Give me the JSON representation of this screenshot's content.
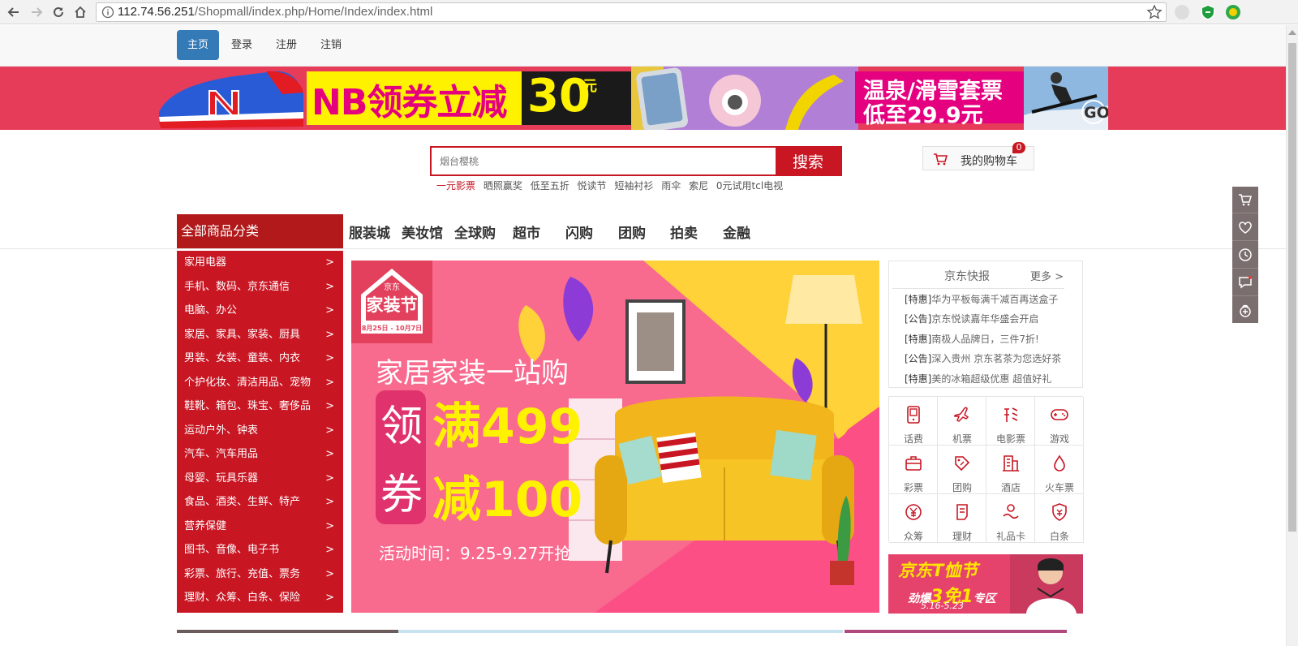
{
  "browser": {
    "url_host": "112.74.56.251",
    "url_path": "/Shopmall/index.php/Home/Index/index.html"
  },
  "topnav": {
    "items": [
      {
        "label": "主页",
        "active": true
      },
      {
        "label": "登录"
      },
      {
        "label": "注册"
      },
      {
        "label": "注销"
      }
    ]
  },
  "banner": {
    "nb_text": "NB领券立减",
    "nb_amount": "30",
    "nb_unit": "元",
    "ski_line1": "温泉/滑雪套票",
    "ski_line2": "低至29.9元",
    "go": "GO"
  },
  "search": {
    "placeholder": "烟台樱桃",
    "button": "搜索",
    "hotwords": [
      "一元影票",
      "晒照赢奖",
      "低至五折",
      "悦读节",
      "短袖衬衫",
      "雨伞",
      "索尼",
      "0元试用tcl电视"
    ]
  },
  "cart": {
    "label": "我的购物车",
    "count": "0"
  },
  "categories": {
    "heading": "全部商品分类",
    "items": [
      "家用电器",
      "手机、数码、京东通信",
      "电脑、办公",
      "家居、家具、家装、厨具",
      "男装、女装、童装、内衣",
      "个护化妆、清洁用品、宠物",
      "鞋靴、箱包、珠宝、奢侈品",
      "运动户外、钟表",
      "汽车、汽车用品",
      "母婴、玩具乐器",
      "食品、酒类、生鲜、特产",
      "营养保健",
      "图书、音像、电子书",
      "彩票、旅行、充值、票务",
      "理财、众筹、白条、保险"
    ],
    "arrow": ">"
  },
  "mainnav": [
    "服装城",
    "美妆馆",
    "全球购",
    "超市",
    "闪购",
    "团购",
    "拍卖",
    "金融"
  ],
  "slider": {
    "badge_top": "京东",
    "badge_main": "家装节",
    "badge_date": "8月25日 - 10月7日",
    "headline": "家居家装一站购",
    "coupon_char1": "领",
    "coupon_char2": "券",
    "offer1": "满499",
    "offer2": "减100",
    "period": "活动时间：9.25-9.27开抢"
  },
  "news": {
    "title": "京东快报",
    "more": "更多 >",
    "items": [
      {
        "tag": "[特惠]",
        "text": "华为平板每满千减百再送盒子"
      },
      {
        "tag": "[公告]",
        "text": "京东悦读嘉年华盛会开启"
      },
      {
        "tag": "[特惠]",
        "text": "南极人品牌日，三件7折!"
      },
      {
        "tag": "[公告]",
        "text": "深入贵州 京东茗茶为您选好茶"
      },
      {
        "tag": "[特惠]",
        "text": "美的冰箱超级优惠 超值好礼"
      }
    ]
  },
  "services": [
    {
      "label": "话费",
      "icon": "phone-bill-icon"
    },
    {
      "label": "机票",
      "icon": "airplane-icon"
    },
    {
      "label": "电影票",
      "icon": "movie-ticket-icon"
    },
    {
      "label": "游戏",
      "icon": "gamepad-icon"
    },
    {
      "label": "彩票",
      "icon": "lottery-icon"
    },
    {
      "label": "团购",
      "icon": "group-buy-icon"
    },
    {
      "label": "酒店",
      "icon": "hotel-icon"
    },
    {
      "label": "火车票",
      "icon": "train-ticket-icon"
    },
    {
      "label": "众筹",
      "icon": "crowdfunding-icon"
    },
    {
      "label": "理财",
      "icon": "finance-icon"
    },
    {
      "label": "礼品卡",
      "icon": "gift-card-icon"
    },
    {
      "label": "白条",
      "icon": "credit-shield-icon"
    }
  ],
  "promo": {
    "line1": "京东T恤节",
    "line2_prefix": "劲爆",
    "line2_big": "3免1",
    "line2_suffix": "专区",
    "line3": "5.16-5.23"
  },
  "sidebar": [
    "cart-icon",
    "heart-icon",
    "history-icon",
    "chat-icon",
    "gift-icon"
  ],
  "colors": {
    "brand_red": "#c81623",
    "category_head": "#b1191a",
    "nav_active": "#337ab7",
    "banner_bg": "#e63c5a"
  }
}
